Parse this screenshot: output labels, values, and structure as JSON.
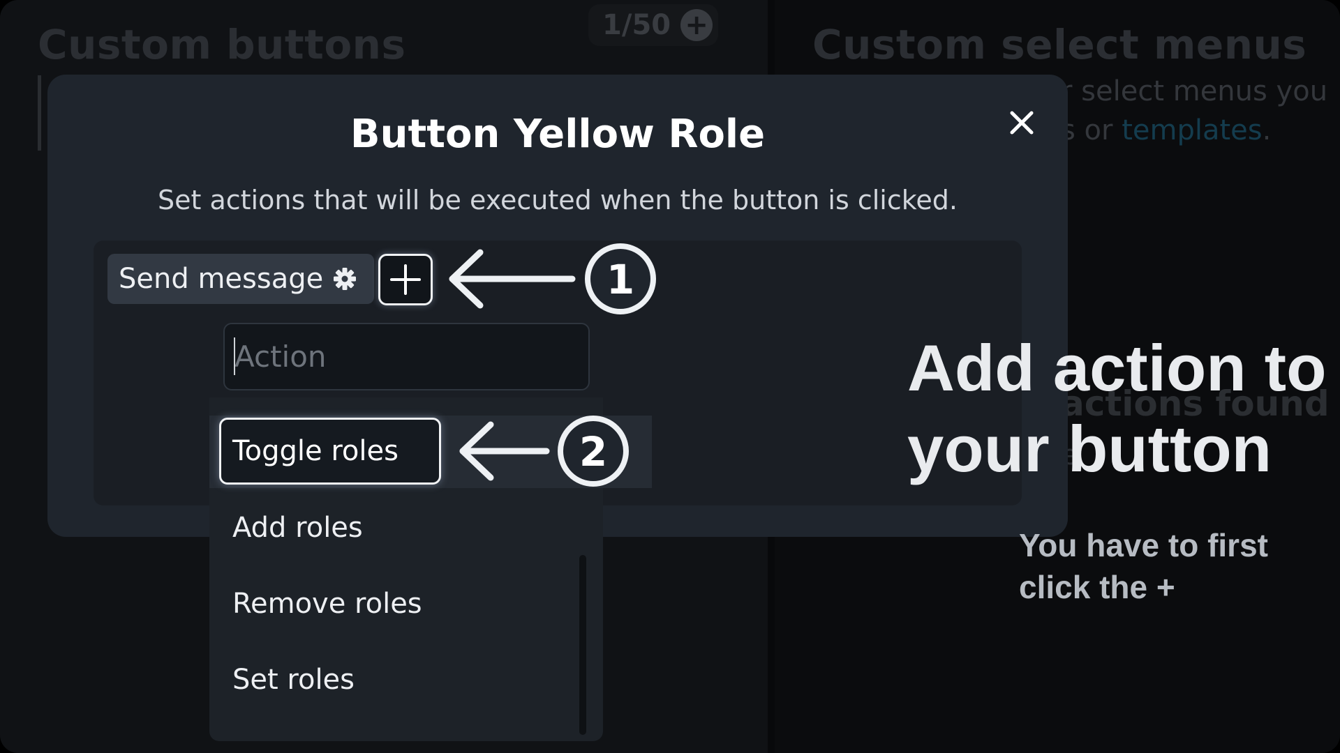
{
  "background": {
    "left_title": "Custom buttons",
    "counter_text": "1/50",
    "counter_icon": "plus-circle-icon",
    "right_title": "Custom select menus",
    "right_desc": "r select menus you",
    "right_links_mid": "s or ",
    "right_link_text": "templates",
    "right_links_end": ".",
    "empty_title": "actions found",
    "empty_sub": "e"
  },
  "modal": {
    "title": "Button Yellow Role",
    "description": "Set actions that will be executed when the button is clicked.",
    "close_icon": "close-icon",
    "action_chip": {
      "label": "Send message",
      "icon": "gear-icon"
    },
    "add_action_icon": "plus-icon",
    "action_input": {
      "value": "",
      "placeholder": "Action"
    },
    "dropdown": {
      "selected": "Toggle roles",
      "options": [
        "Add roles",
        "Remove roles",
        "Set roles"
      ]
    }
  },
  "annotations": {
    "step1": "1",
    "step2": "2",
    "heading_line1": "Add action to",
    "heading_line2": "your button",
    "sub_line1": "You have to first",
    "sub_line2": "click the +"
  },
  "colors": {
    "modal_bg": "#1f252d",
    "accent_link": "#143c4e",
    "highlight_border": "#f1f3f5",
    "annotation_text": "#e9ebee"
  }
}
